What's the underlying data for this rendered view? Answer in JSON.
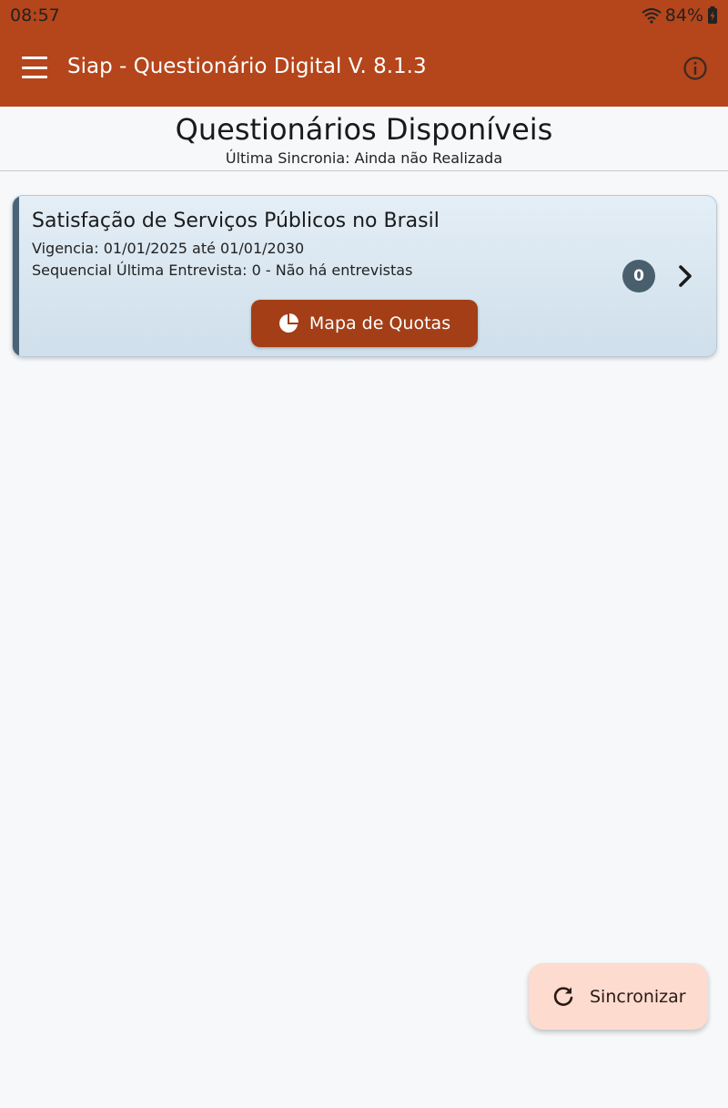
{
  "status_bar": {
    "time": "08:57",
    "battery": "84%",
    "icons": [
      "wifi-icon",
      "battery-charging-icon"
    ]
  },
  "toolbar": {
    "title": "Siap - Questionário Digital V. 8.1.3",
    "menu_icon": "menu-icon",
    "info_icon": "info-icon",
    "color": "#b5451b"
  },
  "header": {
    "title": "Questionários Disponíveis",
    "last_sync": "Última Sincronia: Ainda não Realizada"
  },
  "questionnaires": [
    {
      "title": "Satisfação de Serviços Públicos no Brasil",
      "validity": "Vigencia: 01/01/2025 até 01/01/2030",
      "last_interview": "Sequencial Última Entrevista: 0 - Não há entrevistas",
      "count": "0",
      "quota_button": "Mapa de Quotas",
      "quota_icon": "pie-chart-icon",
      "open_icon": "chevron-right-icon"
    }
  ],
  "fab": {
    "label": "Sincronizar",
    "icon": "refresh-icon",
    "color": "#fddbcf"
  }
}
